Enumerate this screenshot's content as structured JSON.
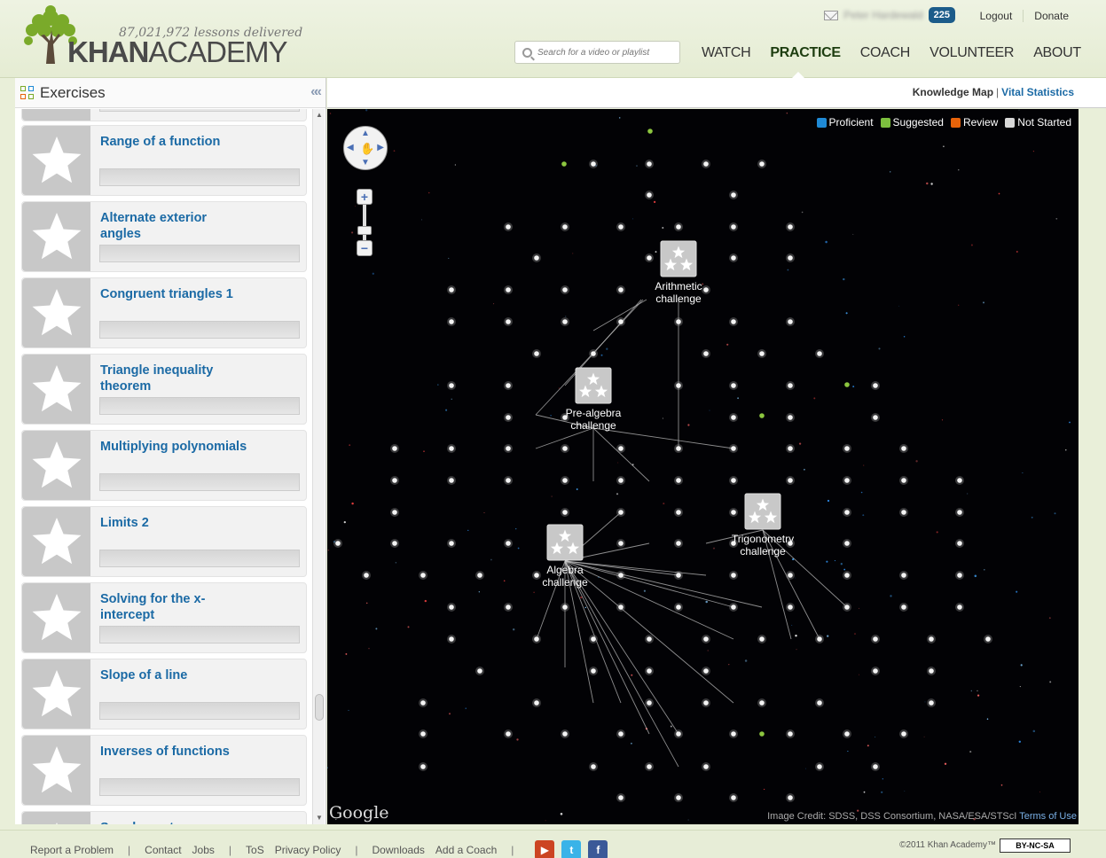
{
  "header": {
    "lessons_delivered": "87,021,972 lessons delivered",
    "logo_bold": "KHAN",
    "logo_thin": "ACADEMY",
    "user_name": "Peter Hardewald",
    "energy_points": "225",
    "top_links": [
      "Logout",
      "Donate"
    ],
    "search_placeholder": "Search for a video or playlist",
    "nav": [
      "WATCH",
      "PRACTICE",
      "COACH",
      "VOLUNTEER",
      "ABOUT"
    ],
    "active_nav": "PRACTICE"
  },
  "sidebar": {
    "title": "Exercises",
    "items": [
      "Range of a function",
      "Alternate exterior angles",
      "Congruent triangles 1",
      "Triangle inequality theorem",
      "Multiplying polynomials",
      "Limits 2",
      "Solving for the x-intercept",
      "Slope of a line",
      "Inverses of functions",
      "Supplementary angles"
    ]
  },
  "map": {
    "links": {
      "knowledge_map": "Knowledge Map",
      "separator": "|",
      "vital_statistics": "Vital Statistics"
    },
    "legend": [
      {
        "label": "Proficient",
        "color": "#1f8ad6"
      },
      {
        "label": "Suggested",
        "color": "#7cbf3e"
      },
      {
        "label": "Review",
        "color": "#e8630a"
      },
      {
        "label": "Not Started",
        "color": "#d8d8d8"
      }
    ],
    "challenges": [
      {
        "line1": "Arithmetic",
        "line2": "challenge"
      },
      {
        "line1": "Pre-algebra",
        "line2": "challenge"
      },
      {
        "line1": "Algebra",
        "line2": "challenge"
      },
      {
        "line1": "Trigonometry",
        "line2": "challenge"
      }
    ],
    "google_label": "Google",
    "image_credit": "Image Credit: SDSS, DSS Consortium, NASA/ESA/STScI",
    "terms_link": "Terms of Use"
  },
  "footer": {
    "links": [
      "Report a Problem",
      "Contact",
      "Jobs",
      "ToS",
      "Privacy Policy",
      "Downloads",
      "Add a Coach"
    ],
    "copyright": "©2011 Khan Academy™",
    "license": "BY-NC-SA"
  }
}
